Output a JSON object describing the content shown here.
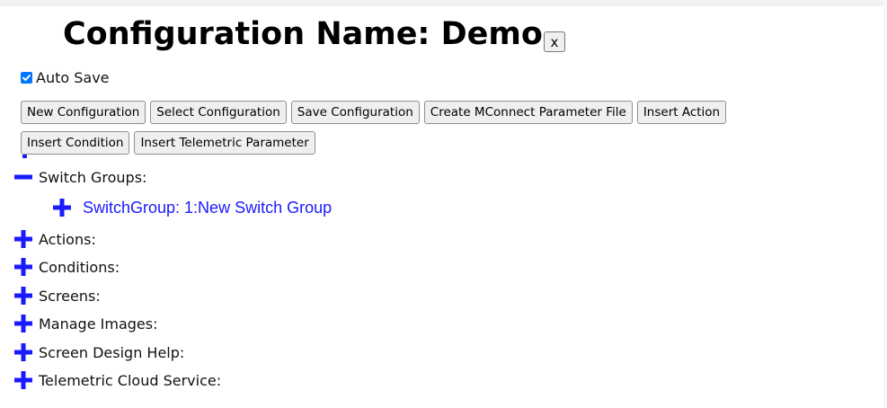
{
  "title": "Configuration Name: Demo",
  "close_label": "x",
  "auto_save": {
    "label": "Auto Save",
    "checked": true
  },
  "toolbar": {
    "row1": [
      "New Configuration",
      "Select Configuration",
      "Save Configuration",
      "Create MConnect Parameter File",
      "Insert Action"
    ],
    "row2": [
      "Insert Condition",
      "Insert Telemetric Parameter"
    ]
  },
  "tree": {
    "switch_groups": {
      "label": "Switch Groups:",
      "state": "expanded"
    },
    "switch_group_item": {
      "label": "SwitchGroup: 1:New Switch Group",
      "state": "collapsed"
    },
    "actions": {
      "label": "Actions:",
      "state": "collapsed"
    },
    "conditions": {
      "label": "Conditions:",
      "state": "collapsed"
    },
    "screens": {
      "label": "Screens:",
      "state": "collapsed"
    },
    "manage_images": {
      "label": "Manage Images:",
      "state": "collapsed"
    },
    "screen_design_help": {
      "label": "Screen Design Help:",
      "state": "collapsed"
    },
    "telemetric_cloud_service": {
      "label": "Telemetric Cloud Service:",
      "state": "collapsed"
    }
  },
  "colors": {
    "tree_icon": "#1a1aff",
    "link": "#1a1aff",
    "checkbox": "#0075ff"
  },
  "icons": {
    "expanded": "minus-icon",
    "collapsed": "plus-icon",
    "close": "close-icon",
    "check": "check-icon"
  }
}
